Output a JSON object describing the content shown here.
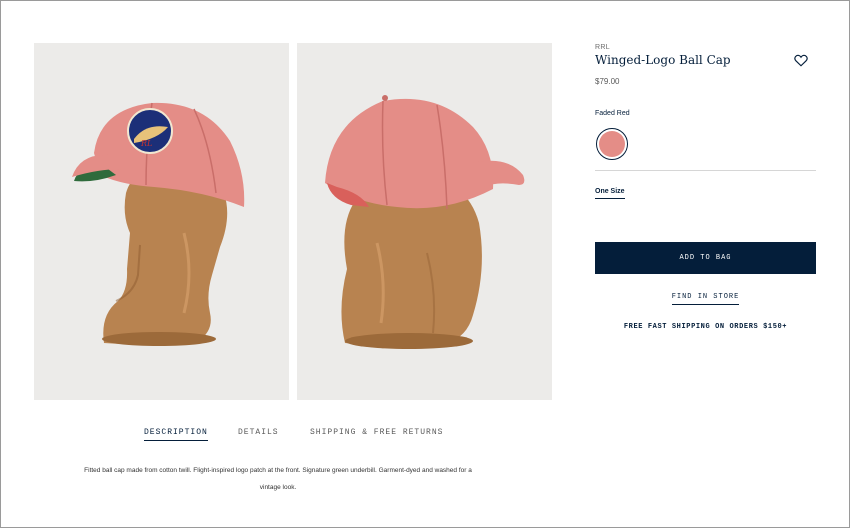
{
  "product": {
    "brand": "RRL",
    "title": "Winged-Logo Ball Cap",
    "price": "$79.00",
    "images": [
      {
        "alt": "Winged-Logo Ball Cap front view"
      },
      {
        "alt": "Winged-Logo Ball Cap back view"
      }
    ]
  },
  "options": {
    "color_label": "Faded Red",
    "swatch_color": "#e48d87",
    "size_label": "One Size"
  },
  "actions": {
    "add_to_bag": "ADD TO BAG",
    "find_in_store": "FIND IN STORE",
    "shipping_note": "FREE FAST SHIPPING ON ORDERS $150+"
  },
  "tabs": [
    {
      "label": "DESCRIPTION",
      "active": true
    },
    {
      "label": "DETAILS",
      "active": false
    },
    {
      "label": "SHIPPING & FREE RETURNS",
      "active": false
    }
  ],
  "description": "Fitted ball cap made from cotton twill. Flight-inspired logo patch at the front. Signature green underbill. Garment-dyed and washed for a vintage look.",
  "colors": {
    "accent": "#041e3a",
    "image_bg": "#ecebe9",
    "cap": "#e48d87",
    "underbill": "#2f6b3c",
    "wood": "#b88350"
  },
  "icons": {
    "favorite": "heart-outline-icon"
  }
}
